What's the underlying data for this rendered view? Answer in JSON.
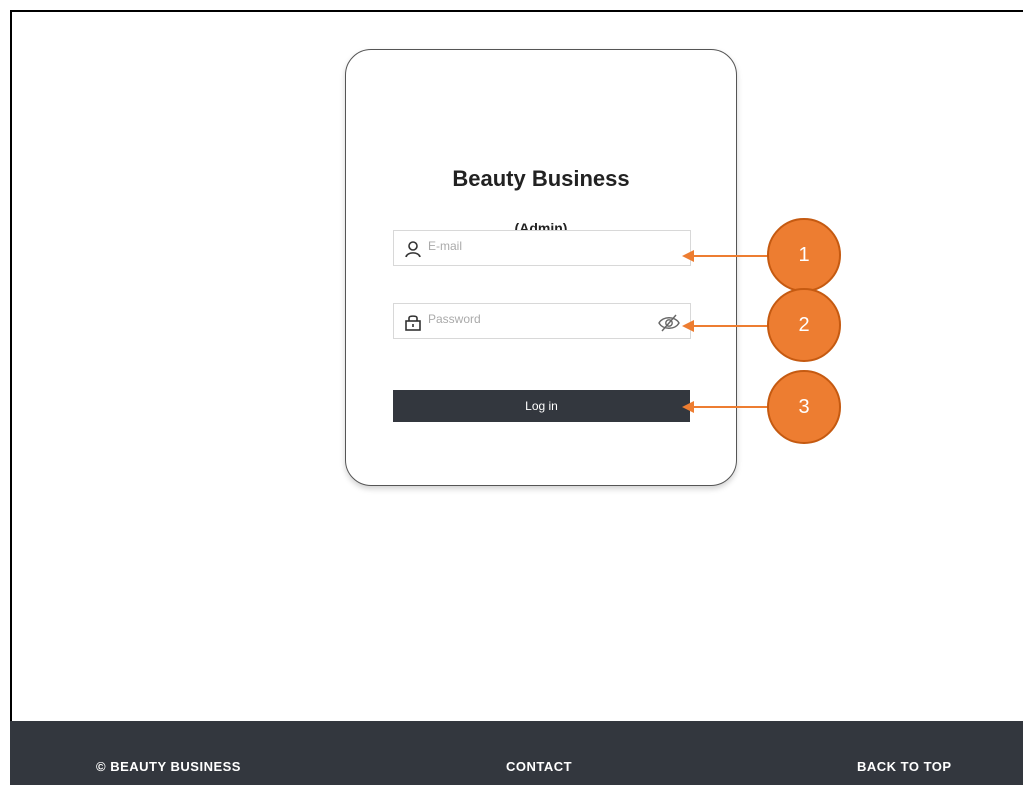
{
  "brand": {
    "title": "Beauty Business",
    "subtitle": "(Admin)"
  },
  "form": {
    "email": {
      "placeholder": "E-mail",
      "icon": "user-icon"
    },
    "password": {
      "placeholder": "Password",
      "icon": "lock-icon",
      "toggle_icon": "eye-slash-icon"
    },
    "login_label": "Log in"
  },
  "callouts": [
    "1",
    "2",
    "3"
  ],
  "footer": {
    "copyright": "© BEAUTY BUSINESS",
    "contact": "CONTACT",
    "back_to_top": "BACK TO TOP"
  },
  "colors": {
    "accent": "#ed7d31",
    "button": "#33373e",
    "footer": "#33373e"
  }
}
